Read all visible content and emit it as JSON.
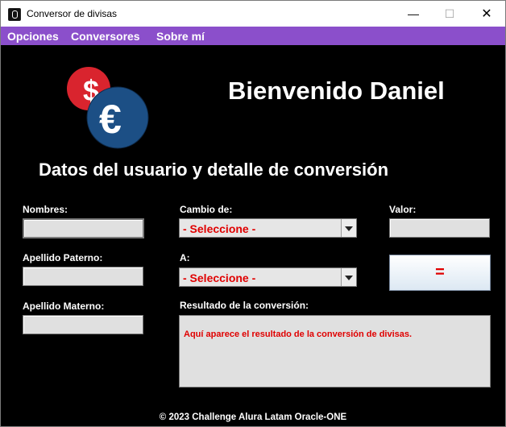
{
  "window": {
    "title": "Conversor de divisas"
  },
  "menu": [
    "Opciones",
    "Conversores",
    "Sobre mí"
  ],
  "header": {
    "welcome": "Bienvenido Daniel",
    "logo_dollar": "$",
    "logo_euro": "€"
  },
  "section": {
    "title": "Datos del usuario y detalle de conversión"
  },
  "form": {
    "nombres_label": "Nombres:",
    "nombres_value": "",
    "apellido_paterno_label": "Apellido Paterno:",
    "apellido_paterno_value": "",
    "apellido_materno_label": "Apellido Materno:",
    "apellido_materno_value": "",
    "cambio_de_label": "Cambio de:",
    "cambio_de_value": "- Seleccione -",
    "a_label": "A:",
    "a_value": "- Seleccione -",
    "valor_label": "Valor:",
    "valor_value": "",
    "convert_button": "=",
    "resultado_label": "Resultado de la conversión:",
    "resultado_text": "Aquí aparece el resultado de la conversión de divisas."
  },
  "footer": "© 2023 Challenge Alura Latam Oracle-ONE",
  "colors": {
    "menu_bg": "#8b4fcb",
    "accent_red": "#e00000",
    "dollar": "#d9242e",
    "euro": "#1c4f85"
  }
}
